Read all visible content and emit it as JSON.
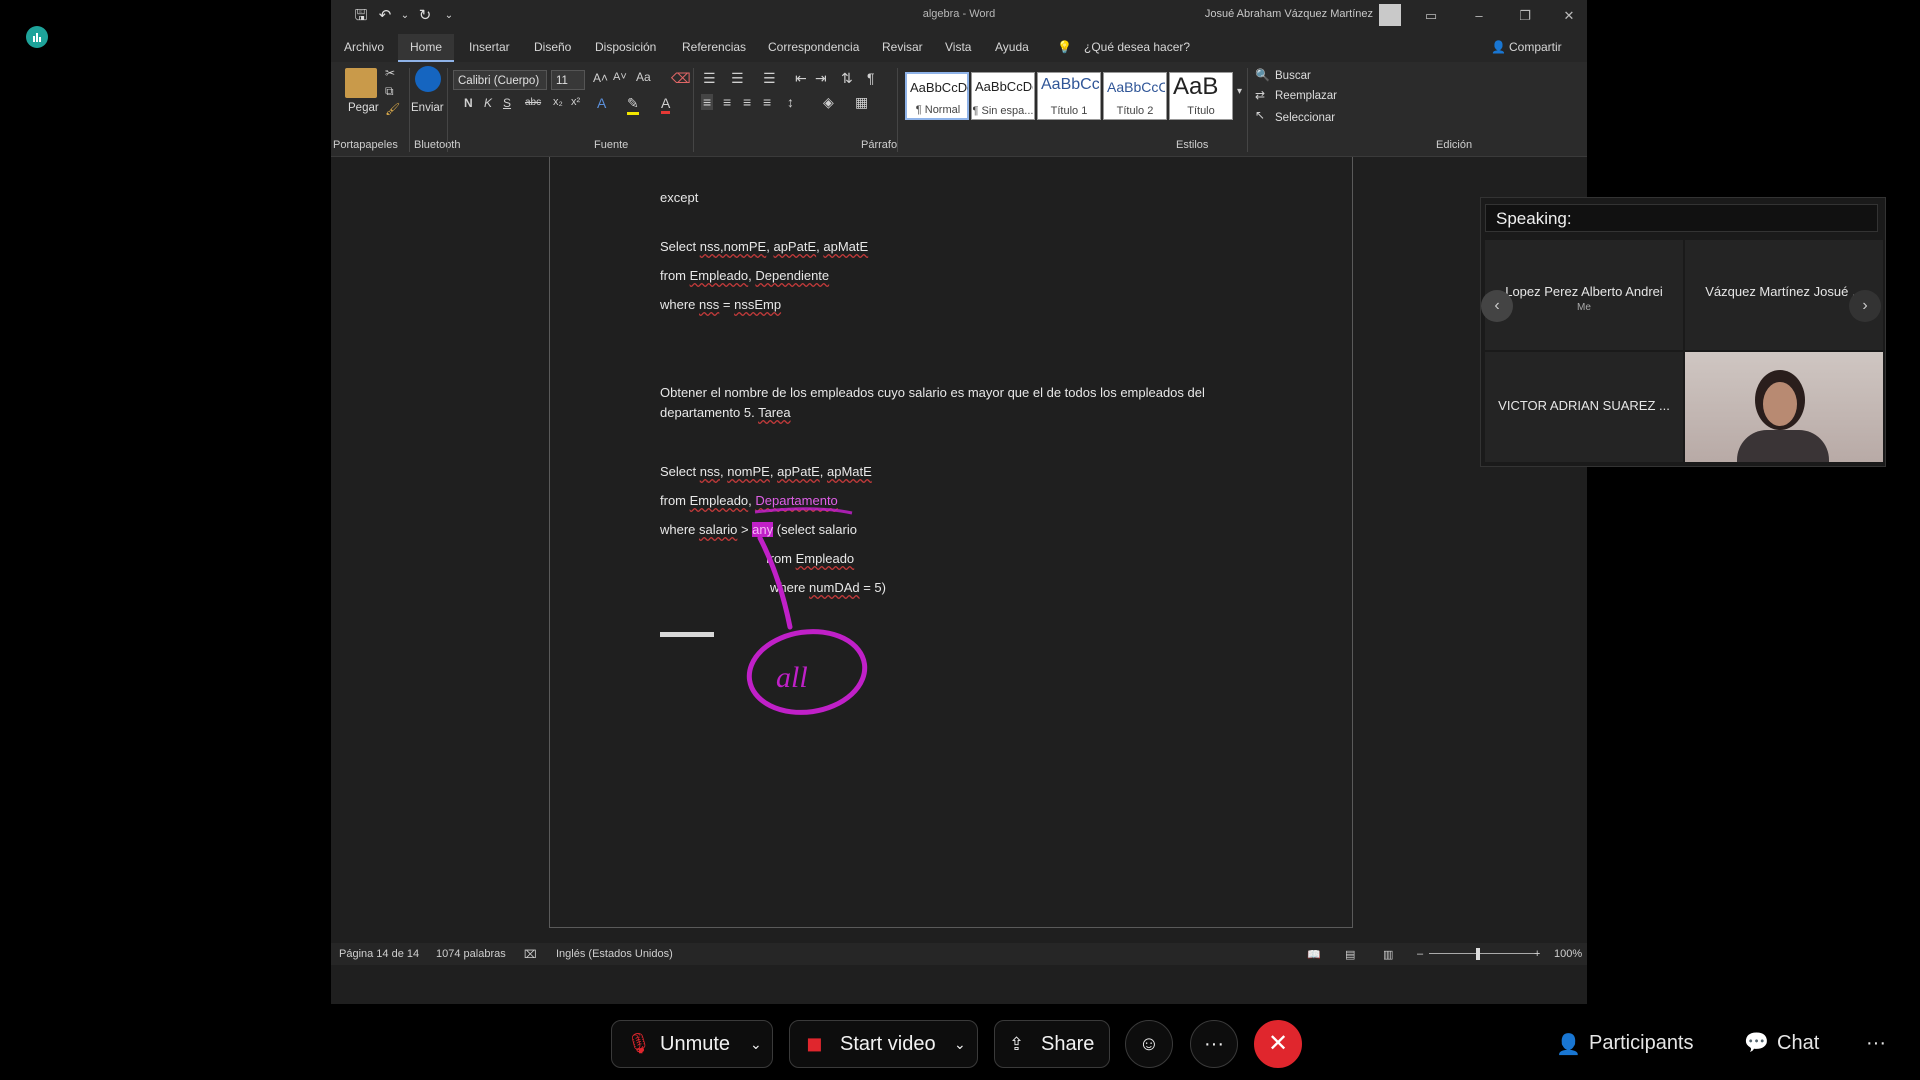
{
  "word": {
    "doc_name": "algebra",
    "app_name": "Word",
    "title_separator": " - ",
    "user_name": "Josué Abraham Vázquez Martínez",
    "menu": [
      "Archivo",
      "Home",
      "Insertar",
      "Diseño",
      "Disposición",
      "Referencias",
      "Correspondencia",
      "Revisar",
      "Vista",
      "Ayuda"
    ],
    "tell_me": "¿Qué desea hacer?",
    "share": "Compartir",
    "ribbon": {
      "paste": "Pegar",
      "send": "Enviar",
      "font_name": "Calibri (Cuerpo)",
      "font_size": "11",
      "bold": "N",
      "italic": "K",
      "underline": "S",
      "case": "Aa",
      "styles": [
        {
          "preview": "AaBbCcDc",
          "name": "¶ Normal"
        },
        {
          "preview": "AaBbCcDc",
          "name": "¶ Sin espa..."
        },
        {
          "preview": "AaBbCc",
          "name": "Título 1"
        },
        {
          "preview": "AaBbCcC",
          "name": "Título 2"
        },
        {
          "preview": "AaB",
          "name": "Título"
        }
      ],
      "find": "Buscar",
      "replace": "Reemplazar",
      "select": "Seleccionar",
      "groups": [
        "Portapapeles",
        "Bluetooth",
        "Fuente",
        "Párrafo",
        "Estilos",
        "Edición"
      ]
    },
    "document": {
      "lines": {
        "l1": "except",
        "l2a": "Select ",
        "l2b": "nss,nomPE",
        "l2c": ", ",
        "l2d": "apPatE",
        "l2e": ", ",
        "l2f": "apMatE",
        "l3a": "from ",
        "l3b": "Empleado",
        "l3c": ", ",
        "l3d": "Dependiente",
        "l4a": "where ",
        "l4b": "nss",
        "l4c": " = ",
        "l4d": "nssEmp",
        "l5": "Obtener el nombre de los empleados cuyo salario es mayor que el de todos los empleados del",
        "l6a": "departamento 5. ",
        "l6b": "Tarea",
        "l7a": "Select ",
        "l7b": "nss",
        "l7c": ", ",
        "l7d": "nomPE",
        "l7e": ", ",
        "l7f": "apPatE",
        "l7g": ", ",
        "l7h": "apMatE",
        "l8a": "from ",
        "l8b": "Empleado",
        "l8c": ", ",
        "l8d": "Departamento",
        "l9a": "where ",
        "l9b": "salario",
        "l9c": " > ",
        "l9d": "any",
        "l9e": " (select salario",
        "l10a": "from ",
        "l10b": "Empleado",
        "l11a": "where ",
        "l11b": "numDAd",
        "l11c": " = 5)"
      },
      "annotation_text": "all"
    },
    "status": {
      "page": "Página 14 de 14",
      "words": "1074 palabras",
      "language": "Inglés (Estados Unidos)",
      "zoom": "100%"
    }
  },
  "meeting": {
    "speaking_label": "Speaking:",
    "participants": [
      {
        "name": "Lopez Perez Alberto Andrei",
        "tag": "Me"
      },
      {
        "name": "Vázquez Martínez Josué ..."
      },
      {
        "name": "VICTOR ADRIAN SUAREZ ..."
      }
    ],
    "controls": {
      "unmute": "Unmute",
      "start_video": "Start video",
      "share": "Share",
      "participants": "Participants",
      "chat": "Chat",
      "more": "···"
    },
    "colors": {
      "leave": "#e0262d",
      "annotation": "#c020c8",
      "accent": "#1ea39a"
    }
  }
}
